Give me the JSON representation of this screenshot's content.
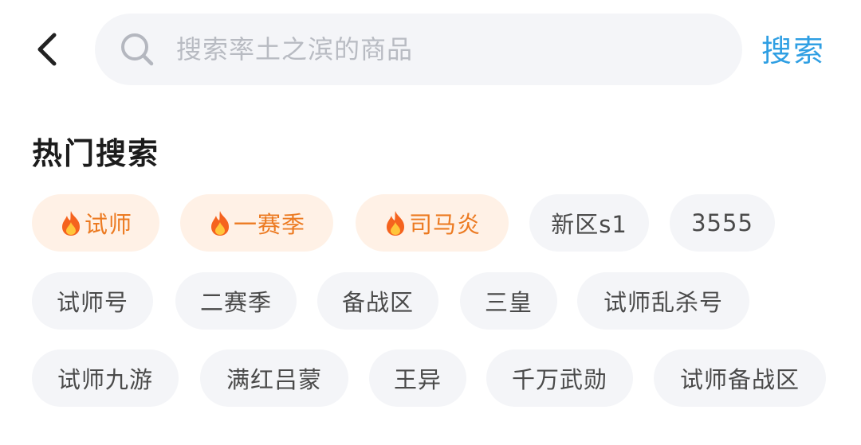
{
  "search": {
    "placeholder": "搜索率土之滨的商品",
    "submit_label": "搜索"
  },
  "hot_search": {
    "title": "热门搜索",
    "rows": [
      [
        {
          "label": "试师",
          "hot": true
        },
        {
          "label": "一赛季",
          "hot": true
        },
        {
          "label": "司马炎",
          "hot": true
        },
        {
          "label": "新区s1",
          "hot": false
        },
        {
          "label": "3555",
          "hot": false
        }
      ],
      [
        {
          "label": "试师号",
          "hot": false
        },
        {
          "label": "二赛季",
          "hot": false
        },
        {
          "label": "备战区",
          "hot": false
        },
        {
          "label": "三皇",
          "hot": false
        },
        {
          "label": "试师乱杀号",
          "hot": false
        }
      ],
      [
        {
          "label": "试师九游",
          "hot": false
        },
        {
          "label": "满红吕蒙",
          "hot": false
        },
        {
          "label": "王异",
          "hot": false
        },
        {
          "label": "千万武勋",
          "hot": false
        },
        {
          "label": "试师备战区",
          "hot": false
        }
      ]
    ]
  },
  "colors": {
    "accent": "#2f9fe3",
    "hot_text": "#ec7a21",
    "hot_bg": "#fff1e6",
    "tag_bg": "#f4f5f8"
  },
  "icons": {
    "back": "chevron-left-icon",
    "search": "search-icon",
    "hot": "fire-icon"
  }
}
